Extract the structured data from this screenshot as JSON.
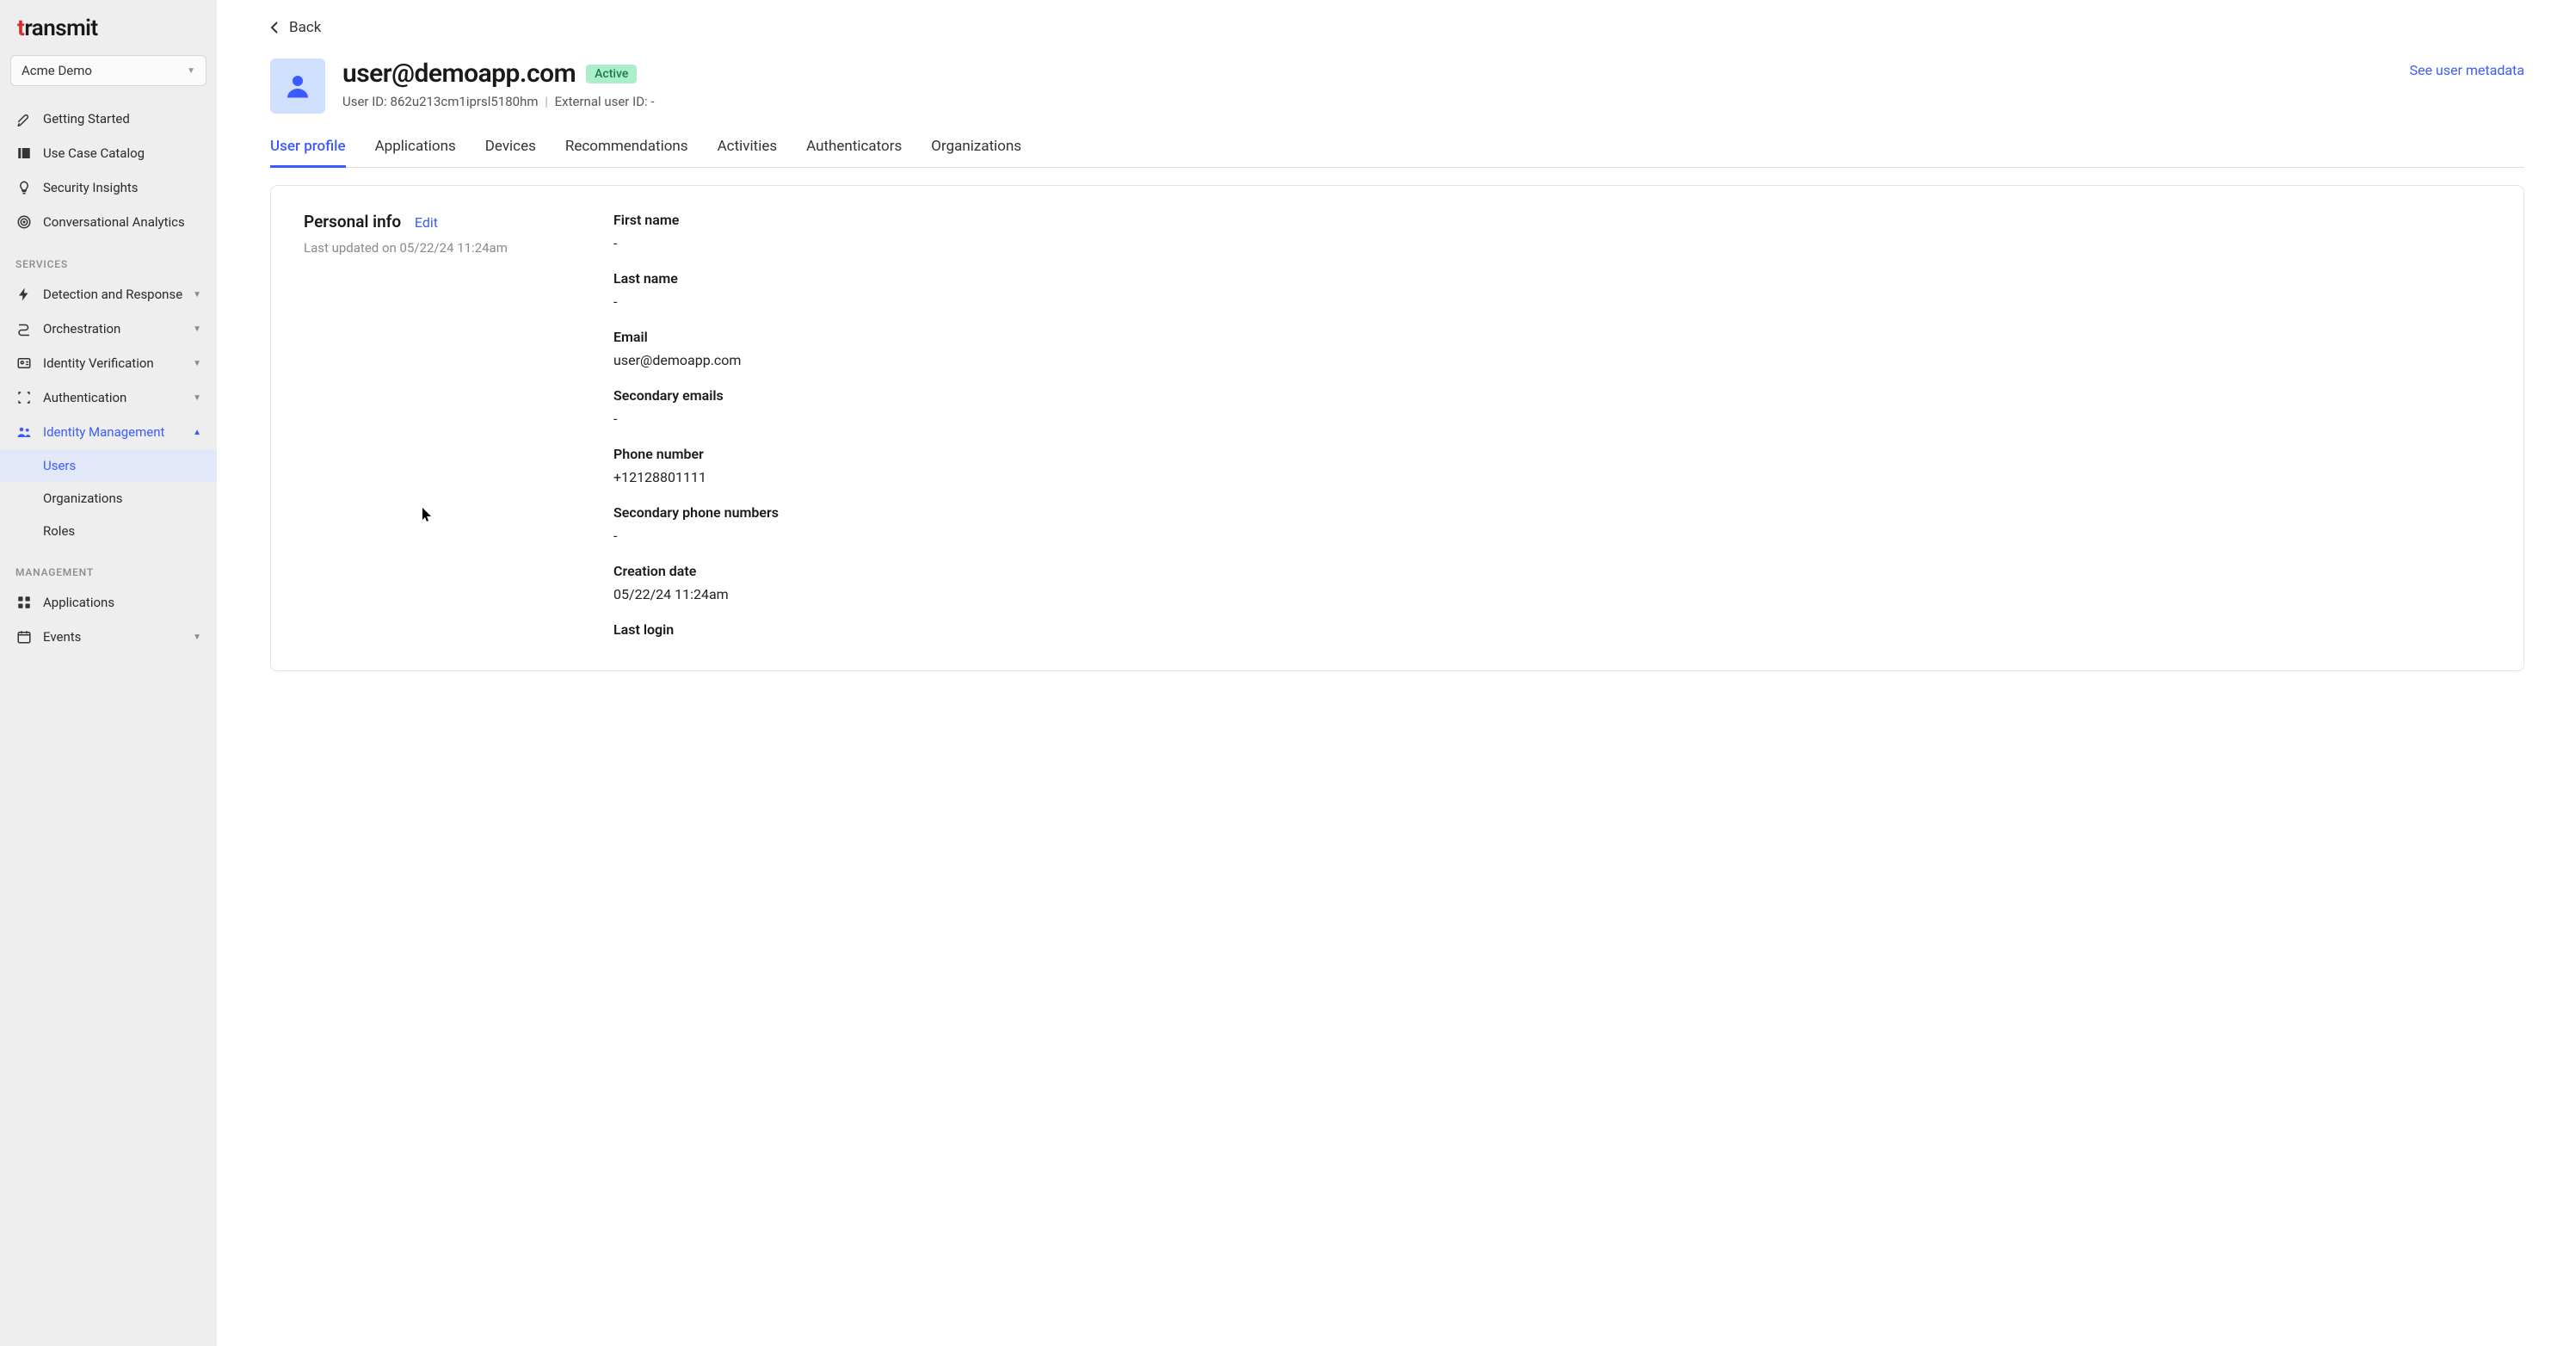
{
  "brand": "transmit",
  "tenant": "Acme Demo",
  "sidebar": {
    "top_items": [
      {
        "label": "Getting Started",
        "icon": "rocket"
      },
      {
        "label": "Use Case Catalog",
        "icon": "catalog"
      },
      {
        "label": "Security Insights",
        "icon": "bulb"
      },
      {
        "label": "Conversational Analytics",
        "icon": "target"
      }
    ],
    "sections": [
      {
        "label": "SERVICES",
        "items": [
          {
            "label": "Detection and Response",
            "icon": "bolt",
            "expandable": true
          },
          {
            "label": "Orchestration",
            "icon": "route",
            "expandable": true
          },
          {
            "label": "Identity Verification",
            "icon": "idcard",
            "expandable": true
          },
          {
            "label": "Authentication",
            "icon": "brackets",
            "expandable": true
          },
          {
            "label": "Identity Management",
            "icon": "people",
            "expandable": true,
            "active": true,
            "children": [
              {
                "label": "Users",
                "selected": true
              },
              {
                "label": "Organizations"
              },
              {
                "label": "Roles"
              }
            ]
          }
        ]
      },
      {
        "label": "MANAGEMENT",
        "items": [
          {
            "label": "Applications",
            "icon": "grid"
          },
          {
            "label": "Events",
            "icon": "calendar",
            "expandable": true
          }
        ]
      }
    ]
  },
  "back_label": "Back",
  "user": {
    "email": "user@demoapp.com",
    "status": "Active",
    "user_id_label": "User ID:",
    "user_id": "862u213cm1iprsl5180hm",
    "ext_id_prefix": "External user ID:",
    "ext_id_value": "-",
    "metadata_link": "See user metadata"
  },
  "tabs": [
    "User profile",
    "Applications",
    "Devices",
    "Recommendations",
    "Activities",
    "Authenticators",
    "Organizations"
  ],
  "profile": {
    "section_title": "Personal info",
    "edit_label": "Edit",
    "updated": "Last updated on 05/22/24 11:24am",
    "fields": [
      {
        "label": "First name",
        "value": "-"
      },
      {
        "label": "Last name",
        "value": "-"
      },
      {
        "label": "Email",
        "value": "user@demoapp.com"
      },
      {
        "label": "Secondary emails",
        "value": "-"
      },
      {
        "label": "Phone number",
        "value": "+12128801111"
      },
      {
        "label": "Secondary phone numbers",
        "value": "-"
      },
      {
        "label": "Creation date",
        "value": "05/22/24 11:24am"
      },
      {
        "label": "Last login",
        "value": ""
      }
    ]
  }
}
